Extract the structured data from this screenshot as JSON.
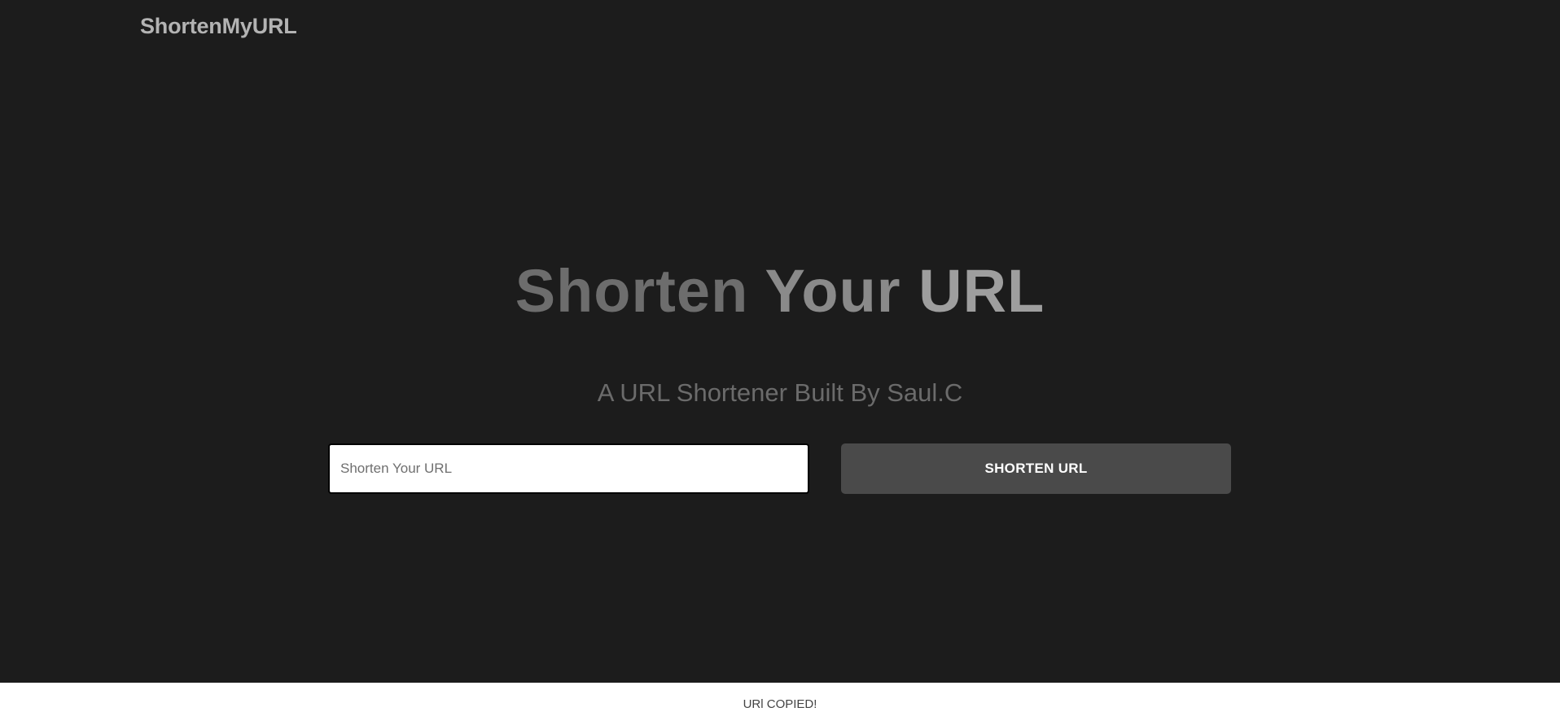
{
  "header": {
    "brand": "ShortenMyURL"
  },
  "hero": {
    "title_words": [
      "Shorten",
      "Your",
      "URL"
    ],
    "subtitle": "A URL Shortener Built By Saul.C"
  },
  "form": {
    "input_placeholder": "Shorten Your URL",
    "input_value": "",
    "button_label": "SHORTEN URL"
  },
  "toast": {
    "message": "URl COPIED!"
  },
  "colors": {
    "background": "#1c1c1c",
    "button": "#4a4a4a",
    "toast_background": "#ffffff"
  }
}
